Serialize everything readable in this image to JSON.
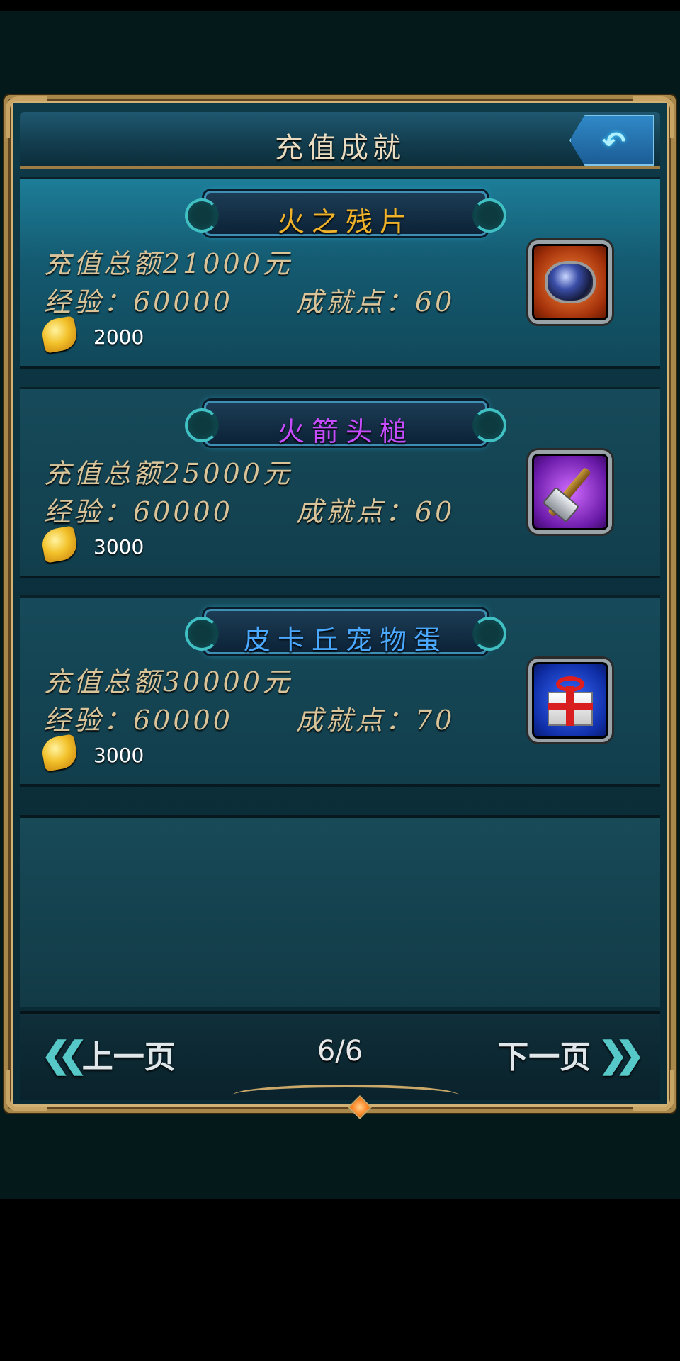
{
  "header": {
    "title": "充值成就",
    "back_icon": "undo-arrow-icon"
  },
  "achievements": [
    {
      "name": "火之残片",
      "name_color": "#f0b22a",
      "total": "充值总额21000元",
      "exp": "经验：60000",
      "points": "成就点：60",
      "gold_icon": "gold-leaf-icon",
      "gold": "2000",
      "item_icon": "blue-gem-orb-icon",
      "active": true
    },
    {
      "name": "火箭头槌",
      "name_color": "#c64cff",
      "total": "充值总额25000元",
      "exp": "经验：60000",
      "points": "成就点：60",
      "gold_icon": "gold-leaf-icon",
      "gold": "3000",
      "item_icon": "hammer-icon",
      "active": false
    },
    {
      "name": "皮卡丘宠物蛋",
      "name_color": "#4aa8ff",
      "total": "充值总额30000元",
      "exp": "经验：60000",
      "points": "成就点：70",
      "gold_icon": "gold-leaf-icon",
      "gold": "3000",
      "item_icon": "gift-box-icon",
      "active": false
    }
  ],
  "pager": {
    "prev_label": "上一页",
    "next_label": "下一页",
    "page": "6/6"
  }
}
